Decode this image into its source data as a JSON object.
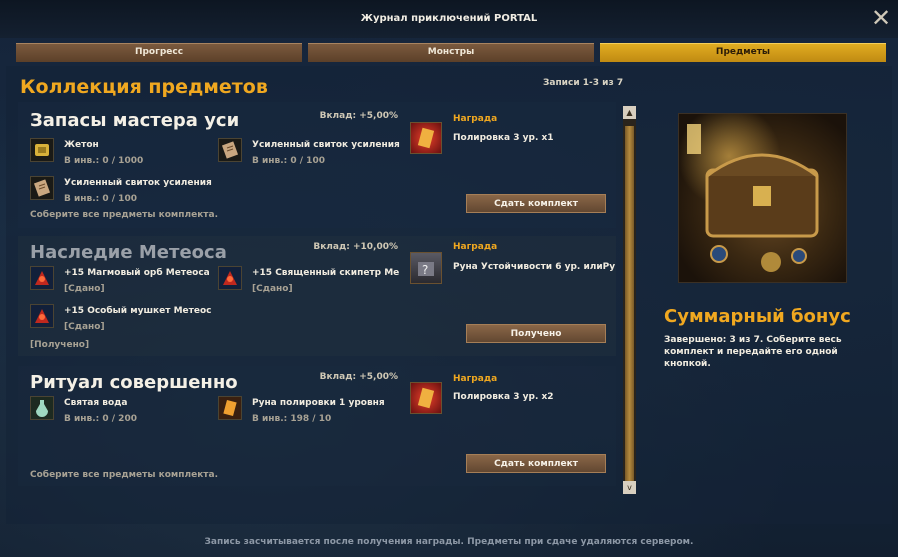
{
  "window": {
    "title": "Журнал приключений PORTAL",
    "close_label": "✕"
  },
  "tabs": [
    {
      "label": "Прогресс",
      "active": false
    },
    {
      "label": "Монстры",
      "active": false
    },
    {
      "label": "Предметы",
      "active": true
    }
  ],
  "main": {
    "heading": "Коллекция предметов",
    "records": "Записи 1-3 из 7"
  },
  "sets": [
    {
      "title": "Запасы мастера уси",
      "contribution": "Вклад: +5,00%",
      "items": [
        {
          "name": "Жетон",
          "count": "В инв.: 0 / 1000",
          "icon": "token-icon"
        },
        {
          "name": "Усиленный свиток усиления",
          "count": "В инв.: 0 / 100",
          "icon": "scroll-icon"
        },
        {
          "name": "Усиленный свиток усиления",
          "count": "В инв.: 0 / 100",
          "icon": "scroll-icon"
        }
      ],
      "hint": "Соберите все предметы комплекта.",
      "reward_label": "Награда",
      "reward_name": "Полировка 3 ур. x1",
      "button": "Сдать комплект"
    },
    {
      "title": "Наследие Метеоса",
      "contribution": "Вклад: +10,00%",
      "items": [
        {
          "name": "+15 Магмовый орб Метеоса",
          "count": "[Сдано]",
          "icon": "orb-icon"
        },
        {
          "name": "+15 Священный скипетр Ме",
          "count": "[Сдано]",
          "icon": "scepter-icon"
        },
        {
          "name": "+15 Особый мушкет Метеос",
          "count": "[Сдано]",
          "icon": "musket-icon"
        }
      ],
      "hint": "[Получено]",
      "reward_label": "Награда",
      "reward_name": "Руна Устойчивости 6 ур. илиРу",
      "button": "Получено"
    },
    {
      "title": "Ритуал совершенно",
      "contribution": "Вклад: +5,00%",
      "items": [
        {
          "name": "Святая вода",
          "count": "В инв.: 0 / 200",
          "icon": "holy-water-icon"
        },
        {
          "name": "Руна полировки 1 уровня",
          "count": "В инв.: 198 / 10",
          "icon": "rune-icon"
        }
      ],
      "hint": "Соберите все предметы комплекта.",
      "reward_label": "Награда",
      "reward_name": "Полировка 3 ур. x2",
      "button": "Сдать комплект"
    }
  ],
  "scrollbar": {
    "up": "▲",
    "down": "v"
  },
  "side": {
    "bonus_title": "Суммарный бонус",
    "bonus_text": "Завершено: 3 из 7.  Соберите весь комплект и передайте его одной кнопкой."
  },
  "footer": "Запись засчитывается после получения награды. Предметы при сдаче удаляются сервером.",
  "colors": {
    "accent": "#f0a820",
    "tab_active": "#d69d1a",
    "button": "#7a5a3e"
  }
}
